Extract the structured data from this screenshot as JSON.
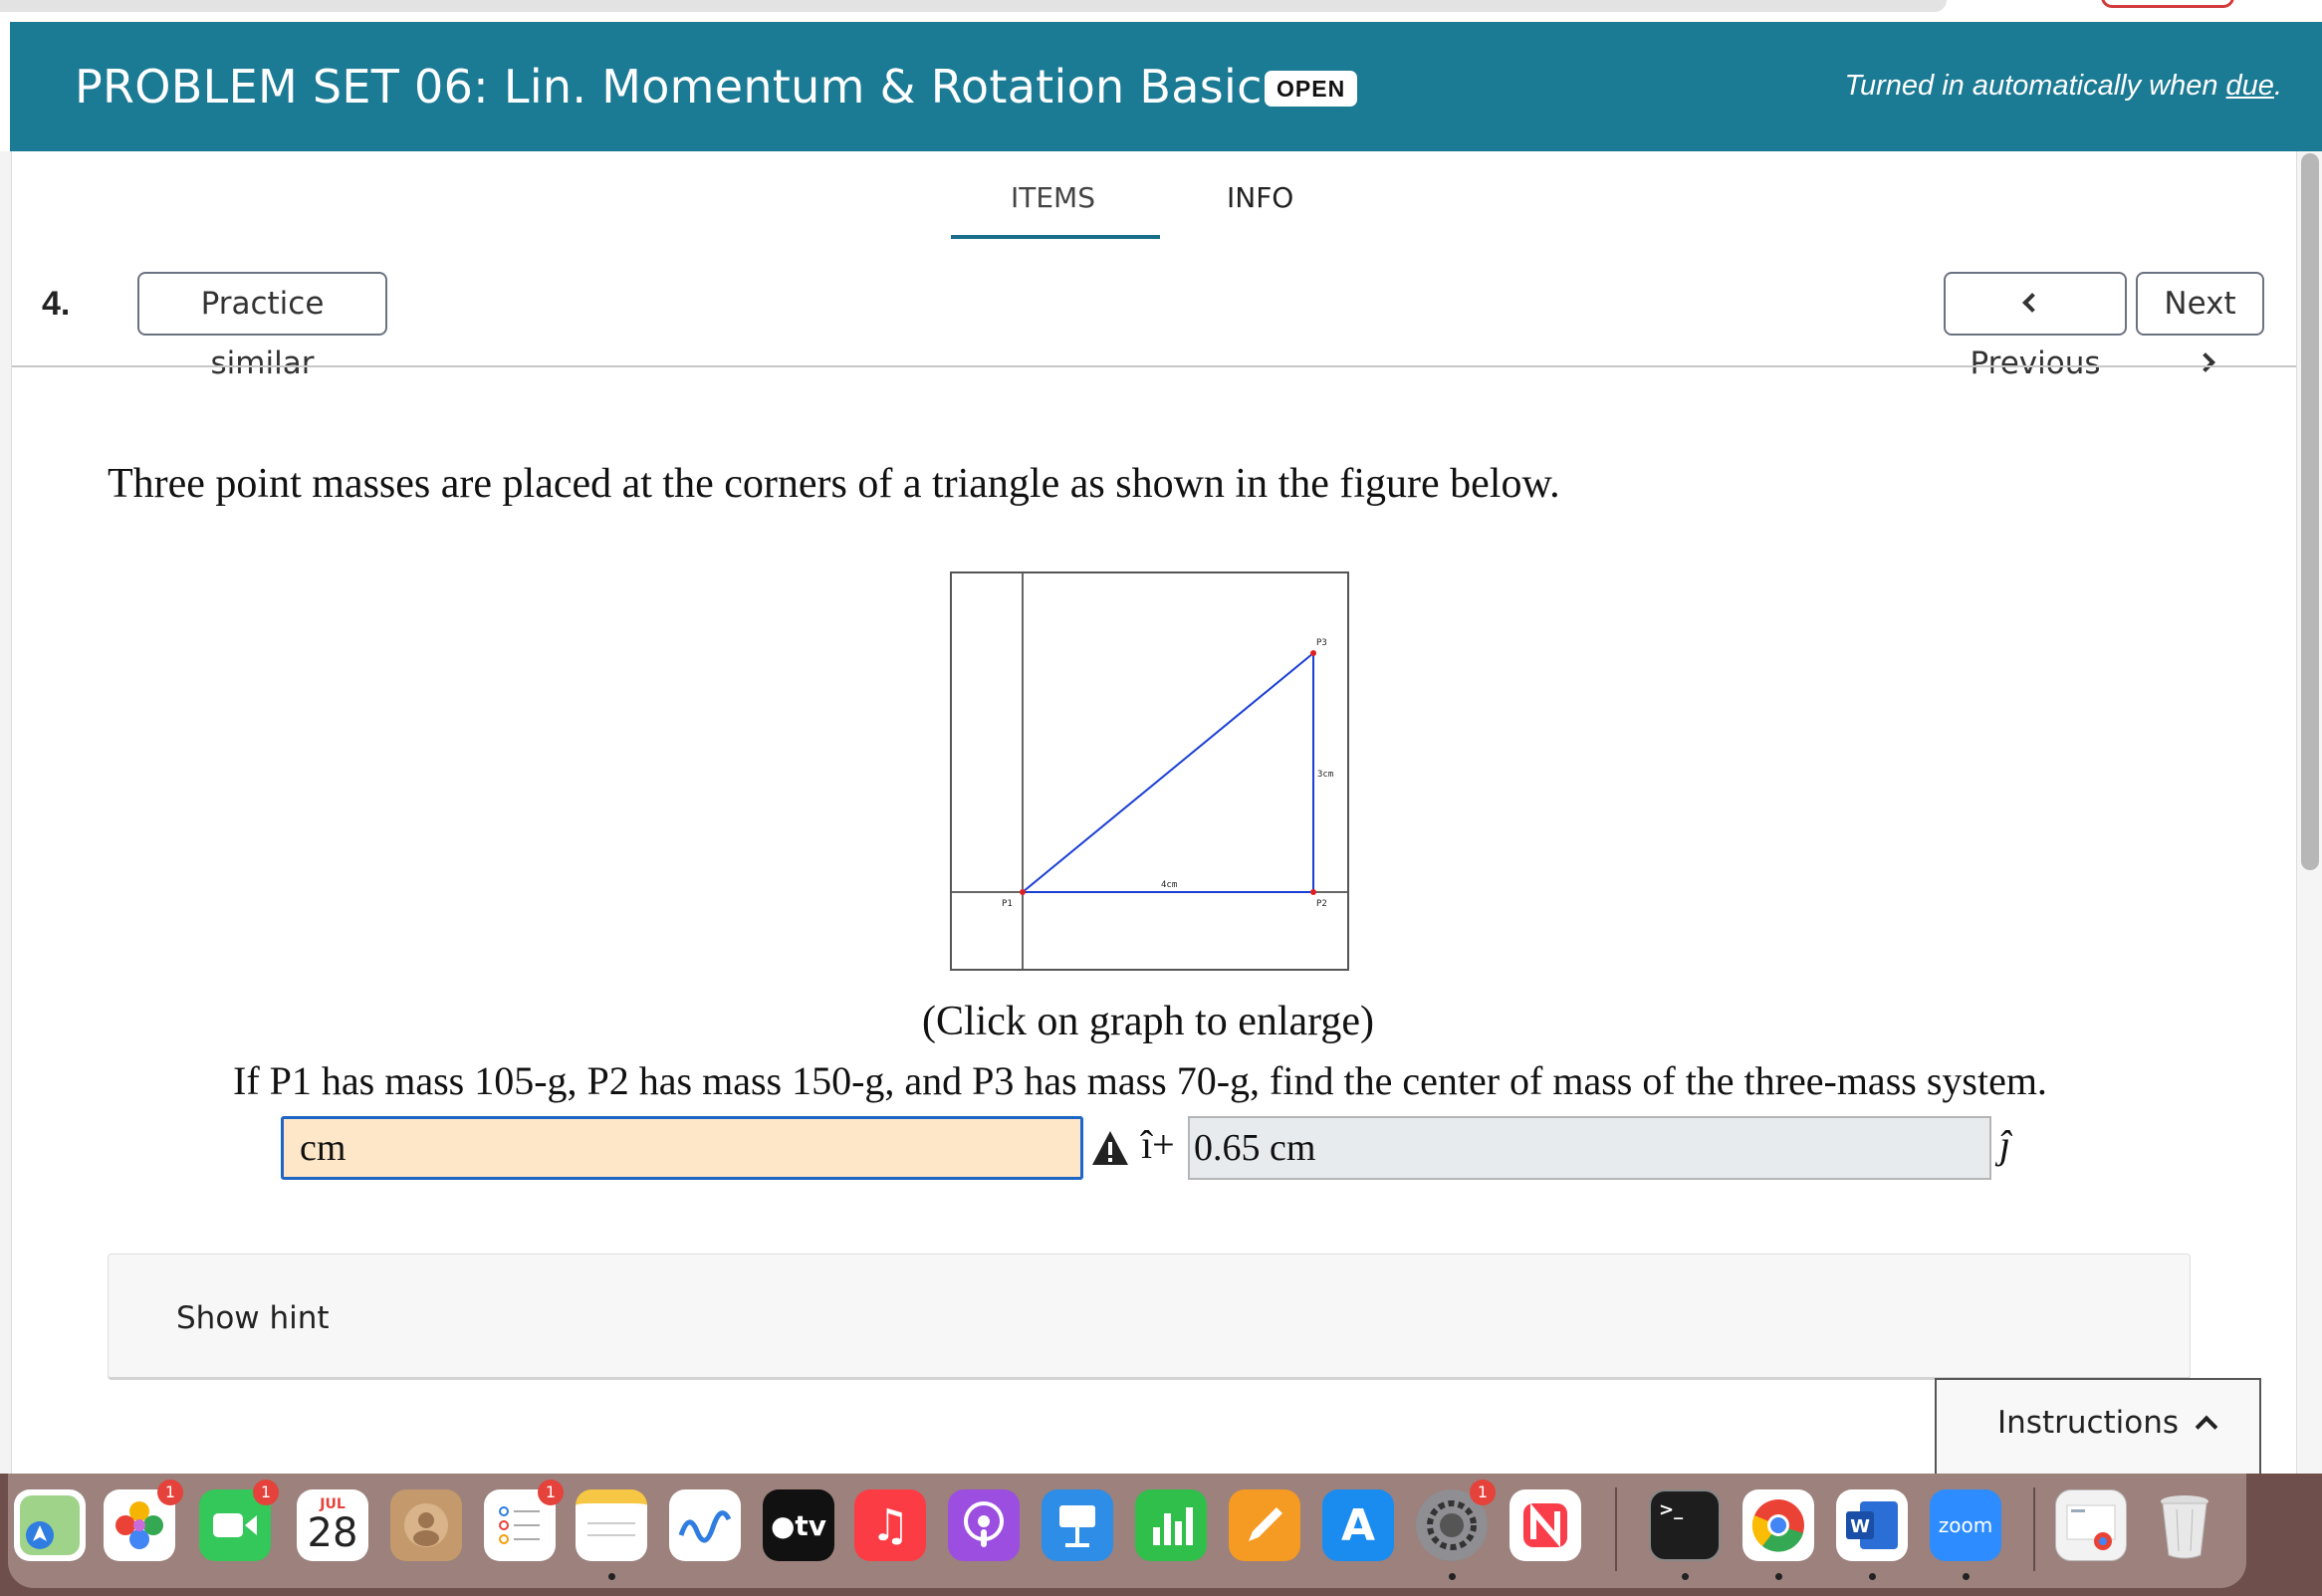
{
  "header": {
    "title": "PROBLEM SET 06: Lin. Momentum & Rotation Basics",
    "badge": "OPEN",
    "turned_text": "Turned in automatically when ",
    "turned_link": "due",
    "turned_suffix": "."
  },
  "tabs": {
    "items": "ITEMS",
    "info": "INFO"
  },
  "question_nav": {
    "number": "4.",
    "practice_label": "Practice similar",
    "previous_label": "Previous",
    "next_label": "Next"
  },
  "problem": {
    "statement": "Three point masses are placed at the corners of a triangle as shown in the figure below.",
    "enlarge_text": "(Click on graph to enlarge)",
    "question": "If P1 has mass 105-g, P2 has mass 150-g, and P3 has mass 70-g, find the center of mass of the three-mass system."
  },
  "figure": {
    "labels": {
      "p1": "P1",
      "p2": "P2",
      "p3": "P3",
      "base": "4cm",
      "height": "3cm"
    },
    "line_color": "#1a3fd6",
    "point_color": "#e02020"
  },
  "answer": {
    "x_value": "cm",
    "i_hat": "î+",
    "y_value": "0.65 cm",
    "j_hat": "ĵ"
  },
  "hint": {
    "label": "Show hint"
  },
  "instructions": {
    "label": "Instructions"
  },
  "dock": {
    "calendar_month": "JUL",
    "calendar_day": "28",
    "tv_label": "tv",
    "zoom_label": "zoom",
    "word_letter": "W",
    "badge_photos": "1",
    "badge_facetime": "1",
    "badge_reminders": "1",
    "badge_settings": "1"
  },
  "colors": {
    "header_bg": "#1b7a94",
    "input_active_bg": "#fde7c8",
    "input_border": "#1e66c4"
  }
}
